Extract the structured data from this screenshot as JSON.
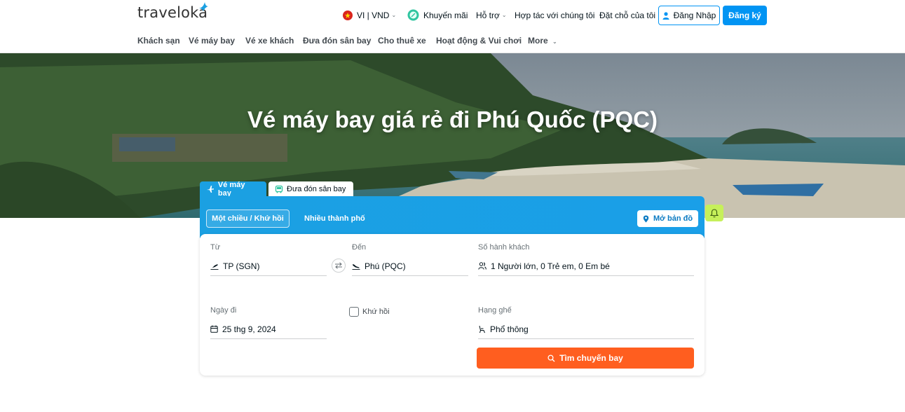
{
  "brand": {
    "name": "traveloka"
  },
  "header": {
    "locale": "VI | VND",
    "promotions": "Khuyến mãi",
    "support": "Hỗ trợ",
    "partner": "Hợp tác với chúng tôi",
    "bookings": "Đặt chỗ của tôi",
    "login": "Đăng Nhập",
    "register": "Đăng ký"
  },
  "nav": [
    {
      "label": "Khách sạn"
    },
    {
      "label": "Vé máy bay"
    },
    {
      "label": "Vé xe khách"
    },
    {
      "label": "Đưa đón sân bay"
    },
    {
      "label": "Cho thuê xe"
    },
    {
      "label": "Hoạt động & Vui chơi"
    },
    {
      "label": "More"
    }
  ],
  "hero": {
    "title": "Vé máy bay giá rẻ đi Phú Quốc (PQC)"
  },
  "tabs": [
    {
      "label": "Vé máy bay",
      "active": true
    },
    {
      "label": "Đưa đón sân bay",
      "active": false
    }
  ],
  "trip_types": {
    "oneway_round": "Một chiều / Khứ hồi",
    "multi_city": "Nhiều thành phố"
  },
  "map_button": "Mở bản đồ",
  "form": {
    "from_label": "Từ",
    "from_value": "TP (SGN)",
    "to_label": "Đến",
    "to_value": "Phú (PQC)",
    "passengers_label": "Số hành khách",
    "passengers_value": "1 Người lớn, 0 Trẻ em, 0 Em bé",
    "depart_label": "Ngày đi",
    "depart_value": "25 thg 9, 2024",
    "return_label": "Khứ hồi",
    "class_label": "Hạng ghế",
    "class_value": "Phổ thông",
    "search_button": "Tìm chuyến bay"
  },
  "colors": {
    "primary": "#0194f3",
    "accent": "#ff5e1f",
    "tab_active": "#1ba0e2",
    "bell": "#c6f05a"
  }
}
